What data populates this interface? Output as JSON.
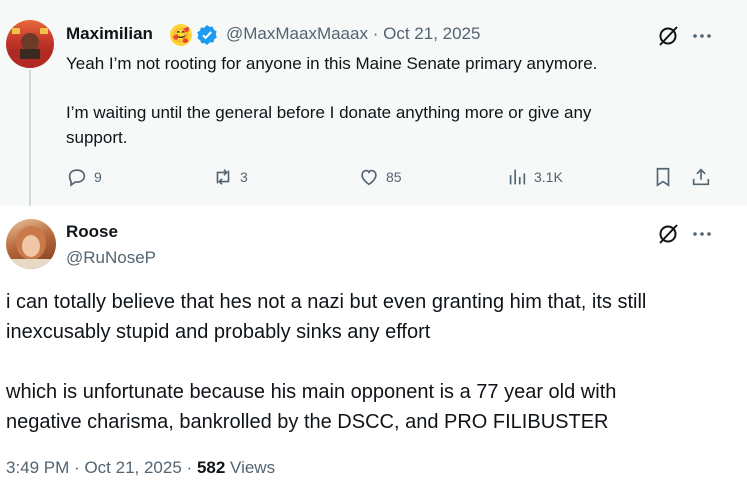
{
  "parent_tweet": {
    "display_name": "Maximilian",
    "badge_emoji": "🥰",
    "handle": "@MaxMaaxMaaax",
    "separator": "·",
    "date": "Oct 21, 2025",
    "text_line1": "Yeah I’m not rooting for anyone in this Maine Senate primary anymore.",
    "text_line2": "I’m waiting until the general before I donate anything more or give any",
    "text_line3": "support.",
    "replies": "9",
    "reposts": "3",
    "likes": "85",
    "views": "3.1K"
  },
  "main_tweet": {
    "display_name": "Roose",
    "handle": "@RuNoseP",
    "text_line1": "i can totally believe that hes not a nazi but even granting him that, its still",
    "text_line2": "inexcusably stupid and probably sinks any effort",
    "text_line3": "which is unfortunate because his main opponent is a 77 year old with",
    "text_line4": "negative charisma, bankrolled by the DSCC, and PRO FILIBUSTER",
    "time": "3:49 PM",
    "date": "Oct 21, 2025",
    "separator": "·",
    "views_count": "582",
    "views_label": "Views"
  },
  "icons": {
    "grok": "grok-icon",
    "more": "more-icon",
    "reply": "reply-icon",
    "repost": "repost-icon",
    "like": "like-icon",
    "views": "views-icon",
    "bookmark": "bookmark-icon",
    "share": "share-icon",
    "verified": "verified-badge-icon"
  },
  "colors": {
    "verified_blue": "#1d9bf0",
    "muted_text": "#536471",
    "parent_bg": "#f7f9f9"
  }
}
